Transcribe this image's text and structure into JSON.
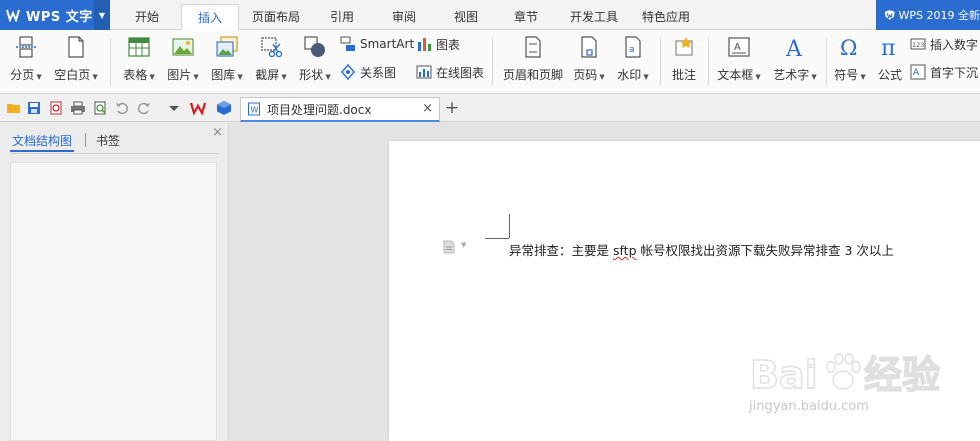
{
  "app": {
    "name": "WPS 文字"
  },
  "tabs": [
    "开始",
    "插入",
    "页面布局",
    "引用",
    "审阅",
    "视图",
    "章节",
    "开发工具",
    "特色应用"
  ],
  "brand": {
    "text": "WPS 2019 全新"
  },
  "ribbon": {
    "page_break": "分页",
    "blank_page": "空白页",
    "table": "表格",
    "picture": "图片",
    "gallery": "图库",
    "screenshot": "截屏",
    "shape": "形状",
    "smartart": "SmartArt",
    "chart": "图表",
    "relation_chart": "关系图",
    "online_chart": "在线图表",
    "header_footer": "页眉和页脚",
    "page_number": "页码",
    "watermark": "水印",
    "comment": "批注",
    "textbox": "文本框",
    "wordart": "艺术字",
    "symbol": "符号",
    "formula": "公式",
    "insert_number": "插入数字",
    "drop_cap": "首字下沉"
  },
  "document_tab": {
    "filename": "项目处理问题.docx"
  },
  "nav_panel": {
    "tab_structure": "文档结构图",
    "tab_bookmark": "书签"
  },
  "document": {
    "text_before": "异常排查：主要是 ",
    "text_misspelled": "sftp",
    "text_after": " 帐号权限找出资源下载失败异常排查 3 次以上"
  },
  "watermark": {
    "text": "Baidu经验",
    "url": "jingyan.baidu.com"
  },
  "colors": {
    "accent": "#2a6ccf",
    "spell_error": "#e03030"
  }
}
